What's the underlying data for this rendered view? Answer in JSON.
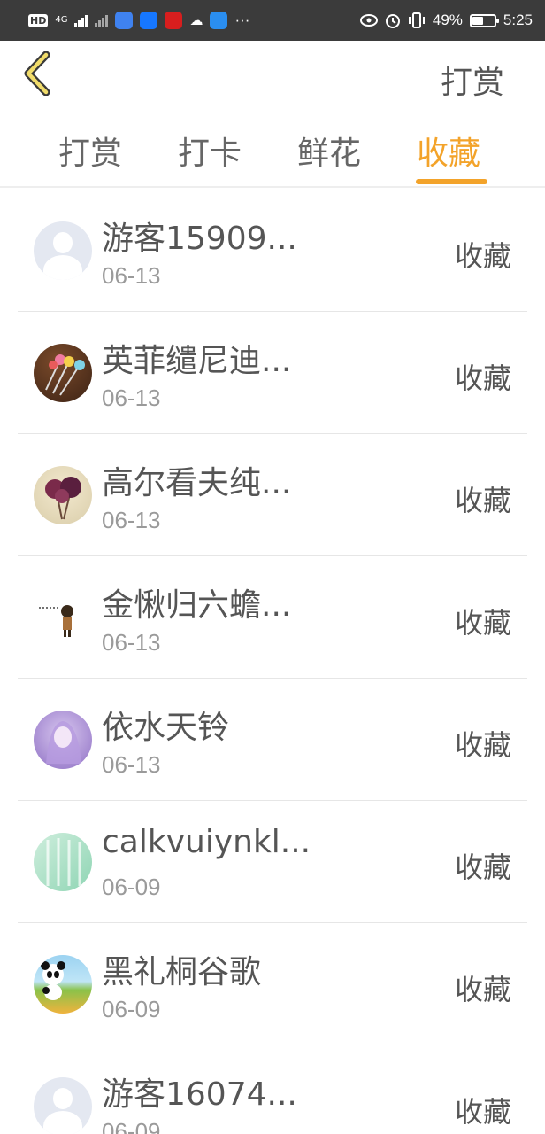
{
  "status_bar": {
    "hd": "HD",
    "net_top": "4G",
    "net_bottom": "4G",
    "battery_percent": "49%",
    "battery_level": 0.49,
    "time": "5:25",
    "more": "···"
  },
  "header": {
    "title": "打赏"
  },
  "tabs": [
    {
      "label": "打赏"
    },
    {
      "label": "打卡"
    },
    {
      "label": "鲜花"
    },
    {
      "label": "收藏"
    }
  ],
  "active_tab": "收藏",
  "accent_color": "#f3a32a",
  "list": [
    {
      "name": "游客15909...",
      "date": "06-13",
      "action": "收藏",
      "avatar": "guest-avatar"
    },
    {
      "name": "英菲缱尼迪...",
      "date": "06-13",
      "action": "收藏",
      "avatar": "pens-avatar"
    },
    {
      "name": "高尔看夫纯...",
      "date": "06-13",
      "action": "收藏",
      "avatar": "flowers-avatar"
    },
    {
      "name": "金愀归六蟾...",
      "date": "06-13",
      "action": "收藏",
      "avatar": "cartoon-avatar"
    },
    {
      "name": "依水天铃",
      "date": "06-13",
      "action": "收藏",
      "avatar": "anime-avatar"
    },
    {
      "name": "calkvuiynkl...",
      "date": "06-09",
      "action": "收藏",
      "avatar": "green-avatar"
    },
    {
      "name": "黑礼桐谷歌",
      "date": "06-09",
      "action": "收藏",
      "avatar": "panda-avatar"
    },
    {
      "name": "游客16074...",
      "date": "06-09",
      "action": "收藏",
      "avatar": "guest-avatar"
    }
  ]
}
